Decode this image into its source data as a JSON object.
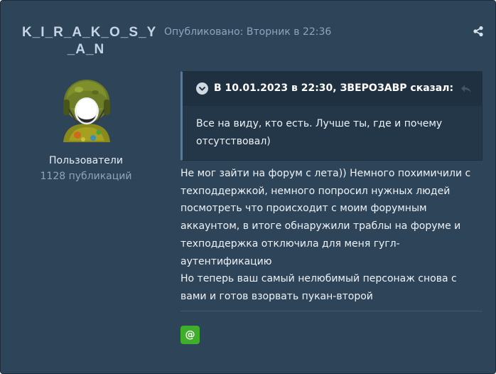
{
  "author": {
    "name_line1": "K_I_R_A_K_O_S_Y",
    "name_line2": "_A_N",
    "group": "Пользователи",
    "posts_count": "1128 публикаций"
  },
  "post": {
    "published": "Опубликовано: Вторник в 22:36",
    "quote": {
      "cite": "В 10.01.2023 в 22:30, ЗВЕРОЗАВР сказал:",
      "text_line1": "Все на виду, кто есть. Лучше ты, где и почему",
      "text_line2": "отсутствовал)"
    },
    "body_lines": [
      "Не мог зайти на форум с лета)) Немного похимичили с",
      "техподдержкой, немного попросил нужных людей",
      "посмотреть что происходит с моим форумным",
      "аккаунтом, в итоге обнаружили траблы на форуме и",
      "техподдержка отключила для меня гугл-",
      "аутентификацию",
      "Но теперь ваш самый нелюбимый персонаж снова с",
      "вами и готов взорвать пукан-второй"
    ],
    "mention_label": "@"
  },
  "icons": {
    "share": "share-icon",
    "quote_toggle": "chevron-down-icon",
    "quote_share": "reply-arrow-icon",
    "avatar": "soldier-helmet-avatar"
  },
  "colors": {
    "background": "#2d4459",
    "quote_background": "#243748",
    "accent_green": "#3fae2a",
    "muted_text": "#8ea6bc"
  }
}
